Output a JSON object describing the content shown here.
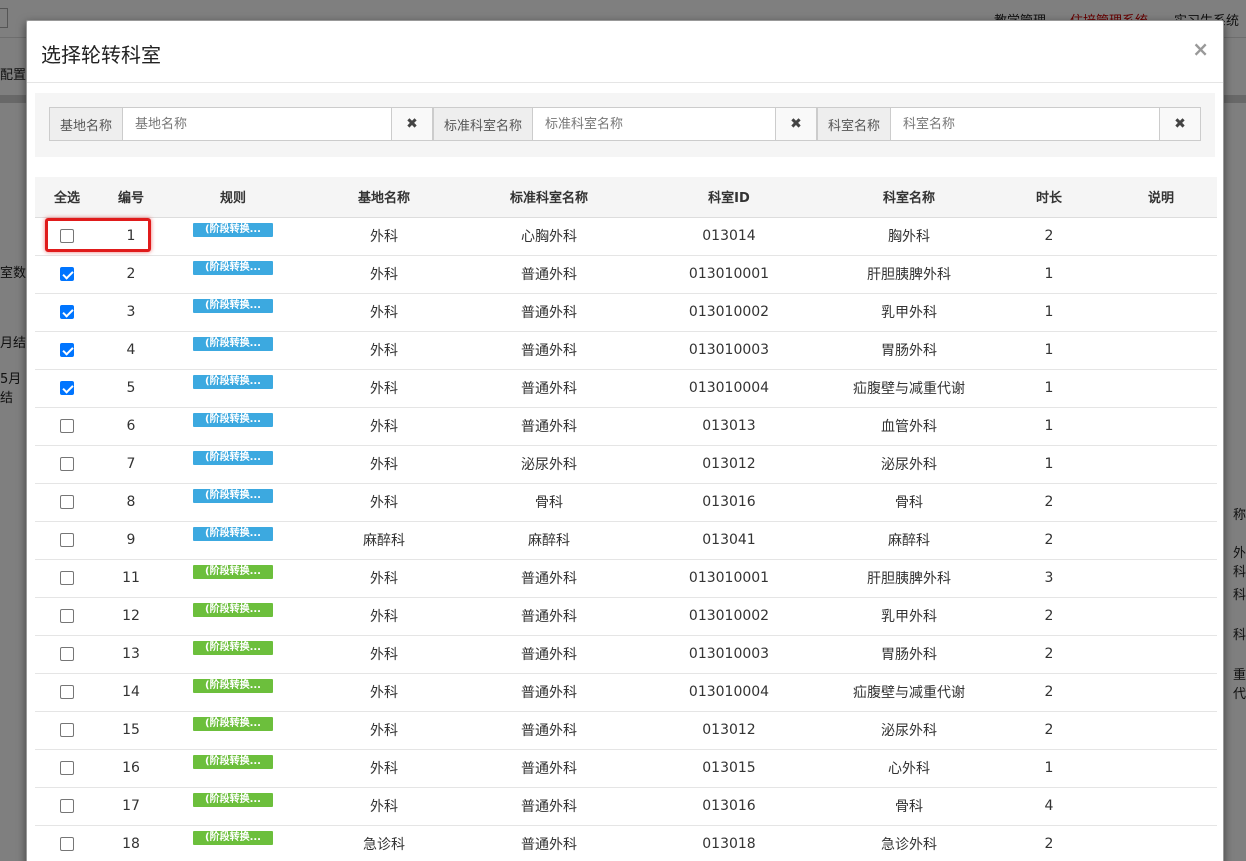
{
  "background": {
    "nav": [
      "教学管理",
      "住培管理系统",
      "实习生系统"
    ],
    "left_fragments": [
      "配置",
      "室数",
      "月结",
      "5月结"
    ],
    "right_fragments": [
      "称",
      "外科",
      "科",
      "科",
      "重代"
    ]
  },
  "modal": {
    "title": "选择轮转科室",
    "close": "×"
  },
  "filters": [
    {
      "label": "基地名称",
      "placeholder": "基地名称",
      "value": "",
      "clear": "✖"
    },
    {
      "label": "标准科室名称",
      "placeholder": "标准科室名称",
      "value": "",
      "clear": "✖"
    },
    {
      "label": "科室名称",
      "placeholder": "科室名称",
      "value": "",
      "clear": "✖"
    }
  ],
  "table": {
    "headers": [
      "全选",
      "编号",
      "规则",
      "基地名称",
      "标准科室名称",
      "科室ID",
      "科室名称",
      "时长",
      "说明"
    ],
    "rows": [
      {
        "checked": false,
        "id": "1",
        "rule": "(阶段转换...",
        "rule_color": "blue",
        "base": "外科",
        "std": "心胸外科",
        "dept_id": "013014",
        "dept": "胸外科",
        "duration": "2",
        "note": ""
      },
      {
        "checked": true,
        "id": "2",
        "rule": "(阶段转换...",
        "rule_color": "blue",
        "base": "外科",
        "std": "普通外科",
        "dept_id": "013010001",
        "dept": "肝胆胰脾外科",
        "duration": "1",
        "note": ""
      },
      {
        "checked": true,
        "id": "3",
        "rule": "(阶段转换...",
        "rule_color": "blue",
        "base": "外科",
        "std": "普通外科",
        "dept_id": "013010002",
        "dept": "乳甲外科",
        "duration": "1",
        "note": ""
      },
      {
        "checked": true,
        "id": "4",
        "rule": "(阶段转换...",
        "rule_color": "blue",
        "base": "外科",
        "std": "普通外科",
        "dept_id": "013010003",
        "dept": "胃肠外科",
        "duration": "1",
        "note": ""
      },
      {
        "checked": true,
        "id": "5",
        "rule": "(阶段转换...",
        "rule_color": "blue",
        "base": "外科",
        "std": "普通外科",
        "dept_id": "013010004",
        "dept": "疝腹壁与减重代谢",
        "duration": "1",
        "note": ""
      },
      {
        "checked": false,
        "id": "6",
        "rule": "(阶段转换...",
        "rule_color": "blue",
        "base": "外科",
        "std": "普通外科",
        "dept_id": "013013",
        "dept": "血管外科",
        "duration": "1",
        "note": ""
      },
      {
        "checked": false,
        "id": "7",
        "rule": "(阶段转换...",
        "rule_color": "blue",
        "base": "外科",
        "std": "泌尿外科",
        "dept_id": "013012",
        "dept": "泌尿外科",
        "duration": "1",
        "note": ""
      },
      {
        "checked": false,
        "id": "8",
        "rule": "(阶段转换...",
        "rule_color": "blue",
        "base": "外科",
        "std": "骨科",
        "dept_id": "013016",
        "dept": "骨科",
        "duration": "2",
        "note": ""
      },
      {
        "checked": false,
        "id": "9",
        "rule": "(阶段转换...",
        "rule_color": "blue",
        "base": "麻醉科",
        "std": "麻醉科",
        "dept_id": "013041",
        "dept": "麻醉科",
        "duration": "2",
        "note": ""
      },
      {
        "checked": false,
        "id": "11",
        "rule": "(阶段转换...",
        "rule_color": "green",
        "base": "外科",
        "std": "普通外科",
        "dept_id": "013010001",
        "dept": "肝胆胰脾外科",
        "duration": "3",
        "note": ""
      },
      {
        "checked": false,
        "id": "12",
        "rule": "(阶段转换...",
        "rule_color": "green",
        "base": "外科",
        "std": "普通外科",
        "dept_id": "013010002",
        "dept": "乳甲外科",
        "duration": "2",
        "note": ""
      },
      {
        "checked": false,
        "id": "13",
        "rule": "(阶段转换...",
        "rule_color": "green",
        "base": "外科",
        "std": "普通外科",
        "dept_id": "013010003",
        "dept": "胃肠外科",
        "duration": "2",
        "note": ""
      },
      {
        "checked": false,
        "id": "14",
        "rule": "(阶段转换...",
        "rule_color": "green",
        "base": "外科",
        "std": "普通外科",
        "dept_id": "013010004",
        "dept": "疝腹壁与减重代谢",
        "duration": "2",
        "note": ""
      },
      {
        "checked": false,
        "id": "15",
        "rule": "(阶段转换...",
        "rule_color": "green",
        "base": "外科",
        "std": "普通外科",
        "dept_id": "013012",
        "dept": "泌尿外科",
        "duration": "2",
        "note": ""
      },
      {
        "checked": false,
        "id": "16",
        "rule": "(阶段转换...",
        "rule_color": "green",
        "base": "外科",
        "std": "普通外科",
        "dept_id": "013015",
        "dept": "心外科",
        "duration": "1",
        "note": ""
      },
      {
        "checked": false,
        "id": "17",
        "rule": "(阶段转换...",
        "rule_color": "green",
        "base": "外科",
        "std": "普通外科",
        "dept_id": "013016",
        "dept": "骨科",
        "duration": "4",
        "note": ""
      },
      {
        "checked": false,
        "id": "18",
        "rule": "(阶段转换...",
        "rule_color": "green",
        "base": "急诊科",
        "std": "普通外科",
        "dept_id": "013018",
        "dept": "急诊外科",
        "duration": "2",
        "note": ""
      }
    ]
  },
  "colors": {
    "rule_blue": "#3ca9e0",
    "rule_green": "#6cbf3c",
    "checkbox_on": "#0075ff",
    "highlight": "#e01b1b"
  }
}
